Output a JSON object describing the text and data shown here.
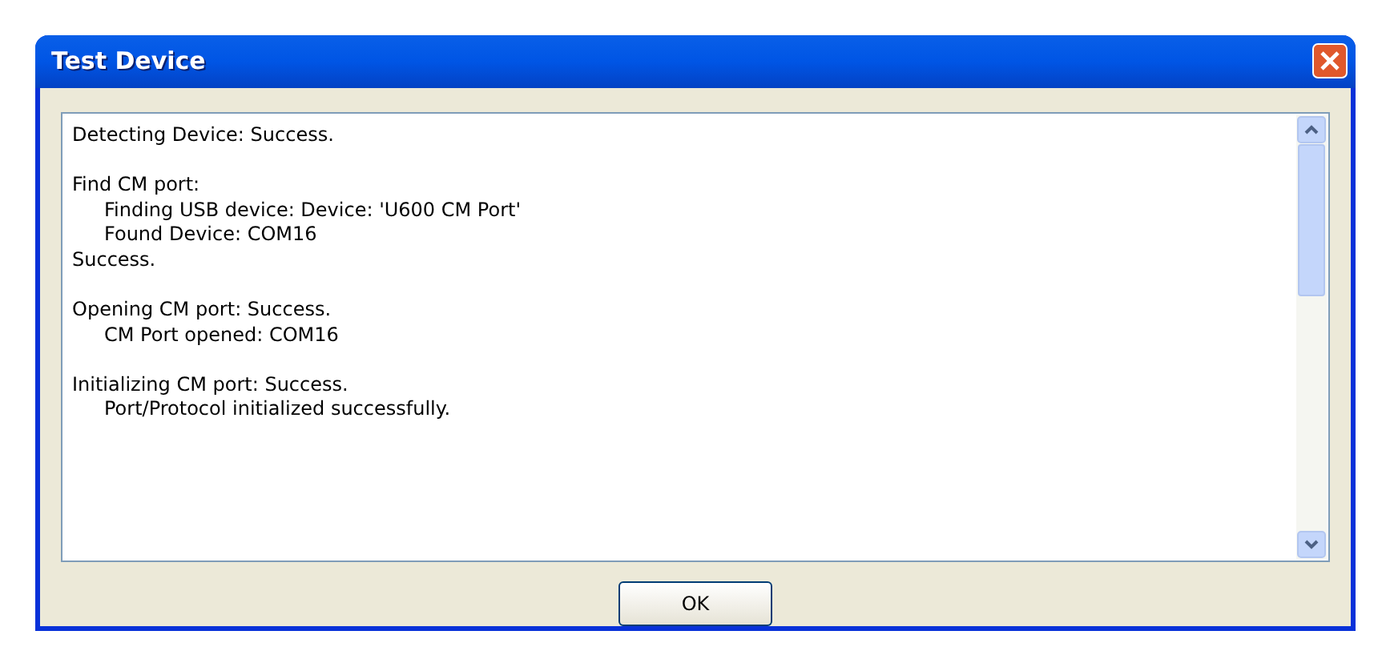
{
  "window": {
    "title": "Test Device"
  },
  "sections": [
    {
      "lines": [
        {
          "text": "Detecting Device: Success."
        }
      ]
    },
    {
      "lines": [
        {
          "text": "Find CM port:",
          "children": [
            {
              "text": "Finding USB device: Device: 'U600 CM Port'"
            },
            {
              "text": "Found Device: COM16"
            }
          ]
        },
        {
          "text": "Success."
        }
      ]
    },
    {
      "lines": [
        {
          "text": "Opening CM port: Success.",
          "children": [
            {
              "text": "CM Port opened: COM16"
            }
          ]
        }
      ]
    },
    {
      "lines": [
        {
          "text": "Initializing CM port: Success.",
          "children": [
            {
              "text": "Port/Protocol initialized successfully."
            }
          ]
        }
      ]
    }
  ],
  "buttons": [
    "OK"
  ]
}
